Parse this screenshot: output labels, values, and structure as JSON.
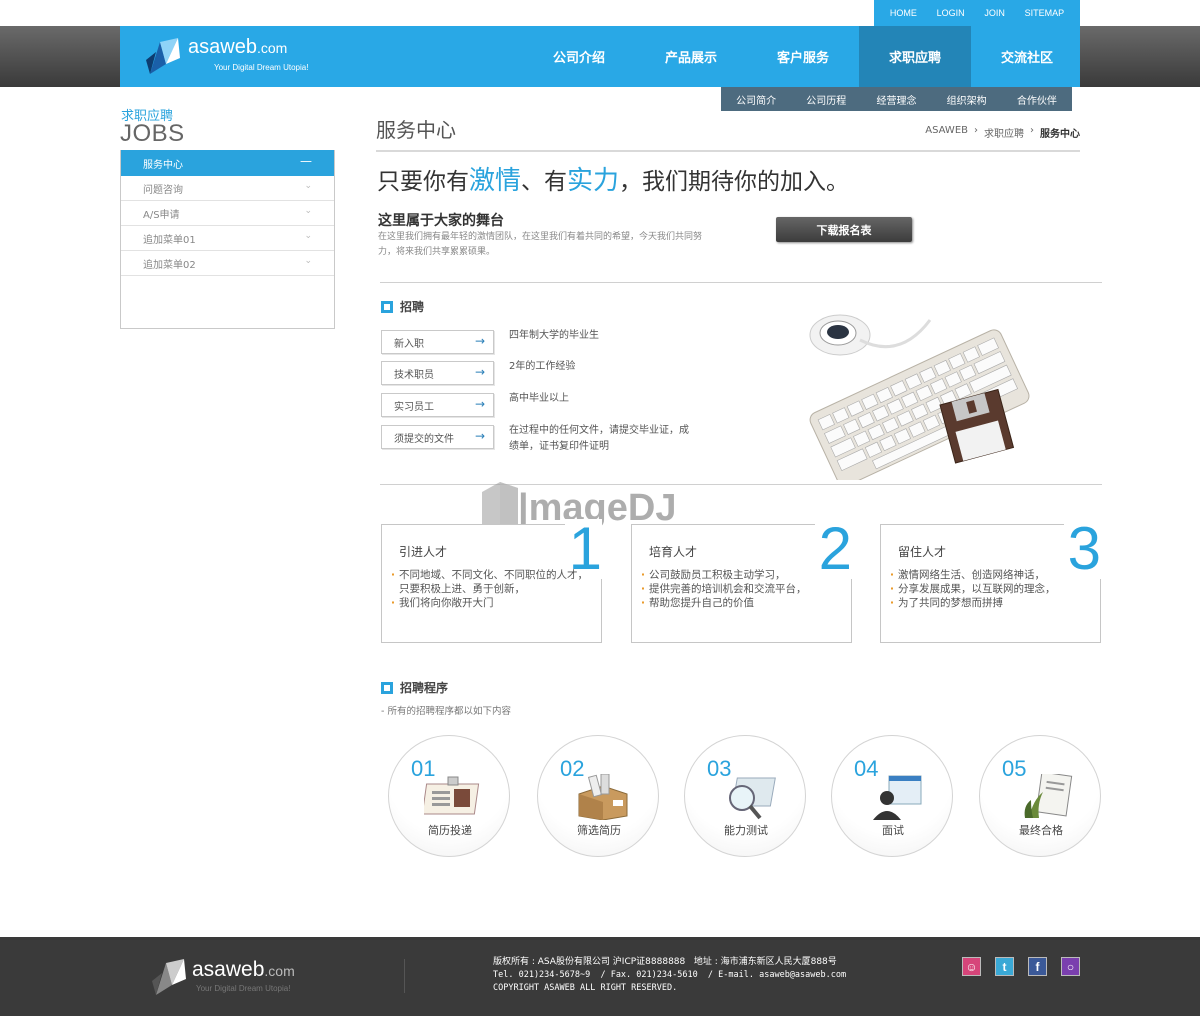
{
  "utility_nav": [
    "HOME",
    "LOGIN",
    "JOIN",
    "SITEMAP"
  ],
  "brand": {
    "name": "asaweb",
    "suffix": ".com",
    "tagline": "Your Digital Dream Utopia!"
  },
  "main_nav": [
    {
      "label": "公司介绍",
      "active": false
    },
    {
      "label": "产品展示",
      "active": false
    },
    {
      "label": "客户服务",
      "active": false
    },
    {
      "label": "求职应聘",
      "active": true
    },
    {
      "label": "交流社区",
      "active": false
    }
  ],
  "sub_nav": [
    "公司简介",
    "公司历程",
    "经营理念",
    "组织架构",
    "合作伙伴"
  ],
  "sidebar": {
    "title_cn": "求职应聘",
    "title_en": "JOBS",
    "items": [
      {
        "label": "服务中心",
        "active": true
      },
      {
        "label": "问题咨询",
        "active": false
      },
      {
        "label": "A/S申请",
        "active": false
      },
      {
        "label": "追加菜单01",
        "active": false
      },
      {
        "label": "追加菜单02",
        "active": false
      }
    ]
  },
  "page": {
    "title": "服务中心",
    "breadcrumb": [
      "ASAWEB",
      "求职应聘",
      "服务中心"
    ],
    "headline": {
      "part1": "只要你有",
      "hl1": "激情",
      "part2": "、有",
      "hl2": "实力",
      "part3": "，我们期待你的加入。"
    },
    "stage_title": "这里属于大家的舞台",
    "stage_desc": "在这里我们拥有最年轻的激情团队，在这里我们有着共同的希望，今天我们共同努力，将来我们共享累累硕果。",
    "download_label": "下载报名表"
  },
  "recruit": {
    "title": "招聘",
    "rows": [
      {
        "label": "新入职",
        "desc": "四年制大学的毕业生"
      },
      {
        "label": "技术职员",
        "desc": "2年的工作经验"
      },
      {
        "label": "实习员工",
        "desc": "高中毕业以上"
      },
      {
        "label": "须提交的文件",
        "desc": "在过程中的任何文件，请提交毕业证，成绩单，证书复印件证明"
      }
    ]
  },
  "cards": [
    {
      "title": "引进人才",
      "num": "1",
      "items": [
        "不同地域、不同文化、不同职位的人才，只要积极上进、勇于创新，",
        "我们将向你敞开大门"
      ]
    },
    {
      "title": "培育人才",
      "num": "2",
      "items": [
        "公司鼓励员工积极主动学习，",
        "提供完善的培训机会和交流平台，",
        "帮助您提升自己的价值"
      ]
    },
    {
      "title": "留住人才",
      "num": "3",
      "items": [
        "激情网络生活、创造网络神话，",
        "分享发展成果，以互联网的理念，",
        "为了共同的梦想而拼搏"
      ]
    }
  ],
  "process": {
    "title": "招聘程序",
    "subtitle": "- 所有的招聘程序都以如下内容",
    "steps": [
      {
        "num": "01",
        "label": "简历投递"
      },
      {
        "num": "02",
        "label": "筛选简历"
      },
      {
        "num": "03",
        "label": "能力测试"
      },
      {
        "num": "04",
        "label": "面试"
      },
      {
        "num": "05",
        "label": "最终合格"
      }
    ]
  },
  "footer": {
    "line1": "版权所有 : ASA股份有限公司 沪ICP证8888888   地址 : 海市浦东新区人民大厦888号",
    "line2": "Tel. 021)234-5678~9  / Fax. 021)234-5610  / E-mail. asaweb@asaweb.com",
    "line3": "COPYRIGHT ASAWEB ALL RIGHT RESERVED."
  },
  "watermark": "imageDJ",
  "colors": {
    "accent": "#29a8e6",
    "nav_active": "#2385b7",
    "subnav": "#4d6b7f",
    "footer": "#3a3a3a"
  }
}
